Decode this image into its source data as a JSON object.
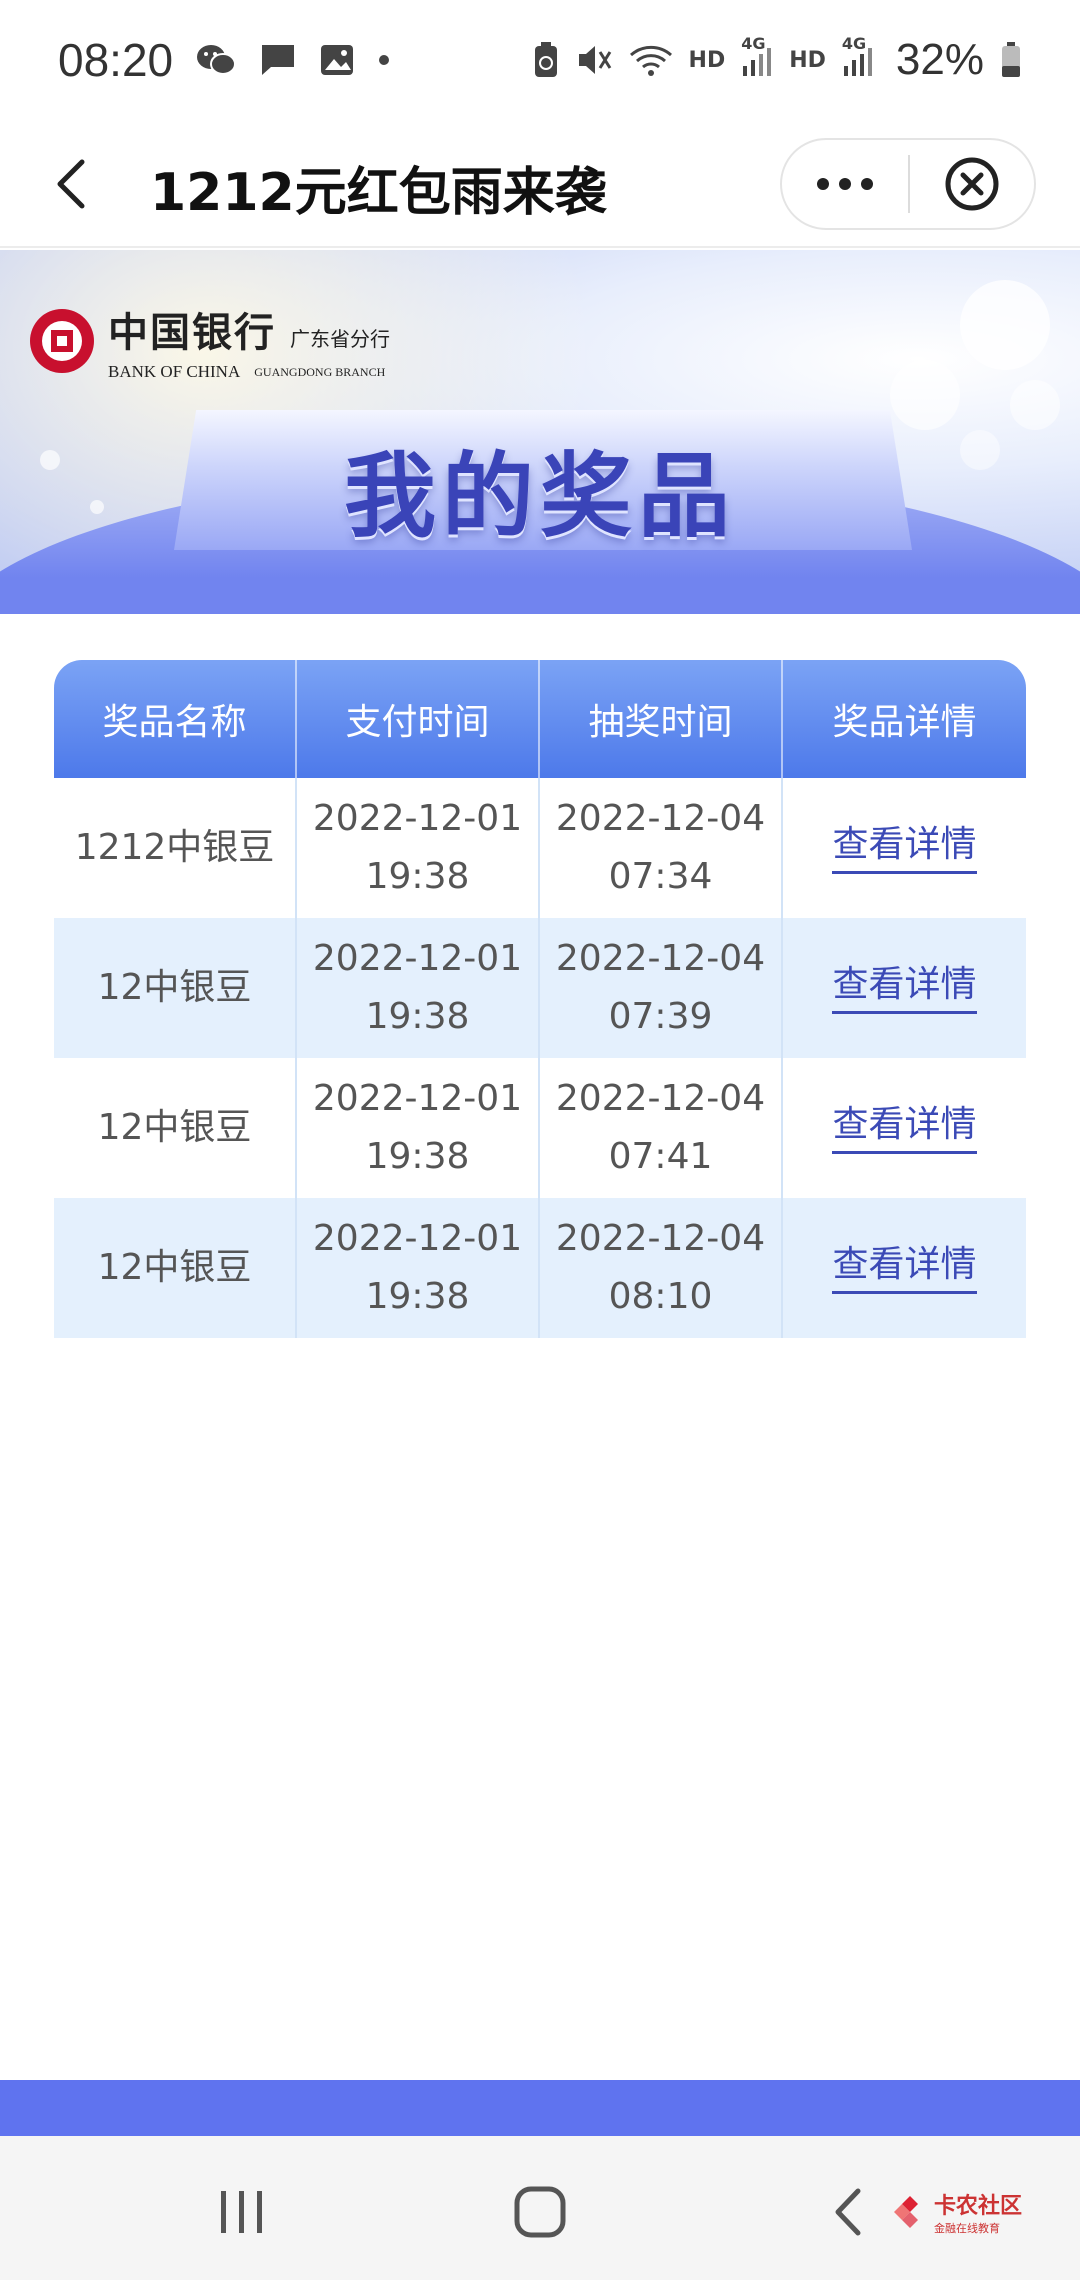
{
  "status_bar": {
    "time": "08:20",
    "network_left": "HD",
    "network_left_gen": "4G",
    "network_right": "HD",
    "network_right_gen": "4G",
    "battery": "32%",
    "icons": [
      "wechat-icon",
      "message-icon",
      "gallery-icon",
      "dot-icon",
      "battery-saver-icon",
      "mute-icon",
      "wifi-icon",
      "signal-icon",
      "signal-icon",
      "battery-icon"
    ]
  },
  "nav": {
    "title": "1212元红包雨来袭",
    "back_icon": "chevron-left-icon",
    "more_icon": "more-dots-icon",
    "close_icon": "close-circle-icon"
  },
  "banner": {
    "bank_name_cn": "中国银行",
    "branch_cn": "广东省分行",
    "bank_name_en": "BANK OF CHINA",
    "branch_en": "GUANGDONG BRANCH",
    "title": "我的奖品"
  },
  "table": {
    "headers": [
      "奖品名称",
      "支付时间",
      "抽奖时间",
      "奖品详情"
    ],
    "rows": [
      {
        "name": "1212中银豆",
        "pay_date": "2022-12-01",
        "pay_time": "19:38",
        "draw_date": "2022-12-04",
        "draw_time": "07:34",
        "link": "查看详情"
      },
      {
        "name": "12中银豆",
        "pay_date": "2022-12-01",
        "pay_time": "19:38",
        "draw_date": "2022-12-04",
        "draw_time": "07:39",
        "link": "查看详情"
      },
      {
        "name": "12中银豆",
        "pay_date": "2022-12-01",
        "pay_time": "19:38",
        "draw_date": "2022-12-04",
        "draw_time": "07:41",
        "link": "查看详情"
      },
      {
        "name": "12中银豆",
        "pay_date": "2022-12-01",
        "pay_time": "19:38",
        "draw_date": "2022-12-04",
        "draw_time": "08:10",
        "link": "查看详情"
      }
    ]
  },
  "system_nav": {
    "recents_icon": "recents-icon",
    "home_icon": "home-icon",
    "back_icon": "back-icon"
  },
  "watermark": {
    "main": "卡农社区",
    "sub": "金融在线教育"
  },
  "colors": {
    "accent_band": "#5f73ef",
    "header_top": "#7ba3f5",
    "header_bottom": "#4d79ea",
    "row_alt": "#e4f0fd",
    "link": "#3b4ab6",
    "boc_red": "#c8102e"
  }
}
